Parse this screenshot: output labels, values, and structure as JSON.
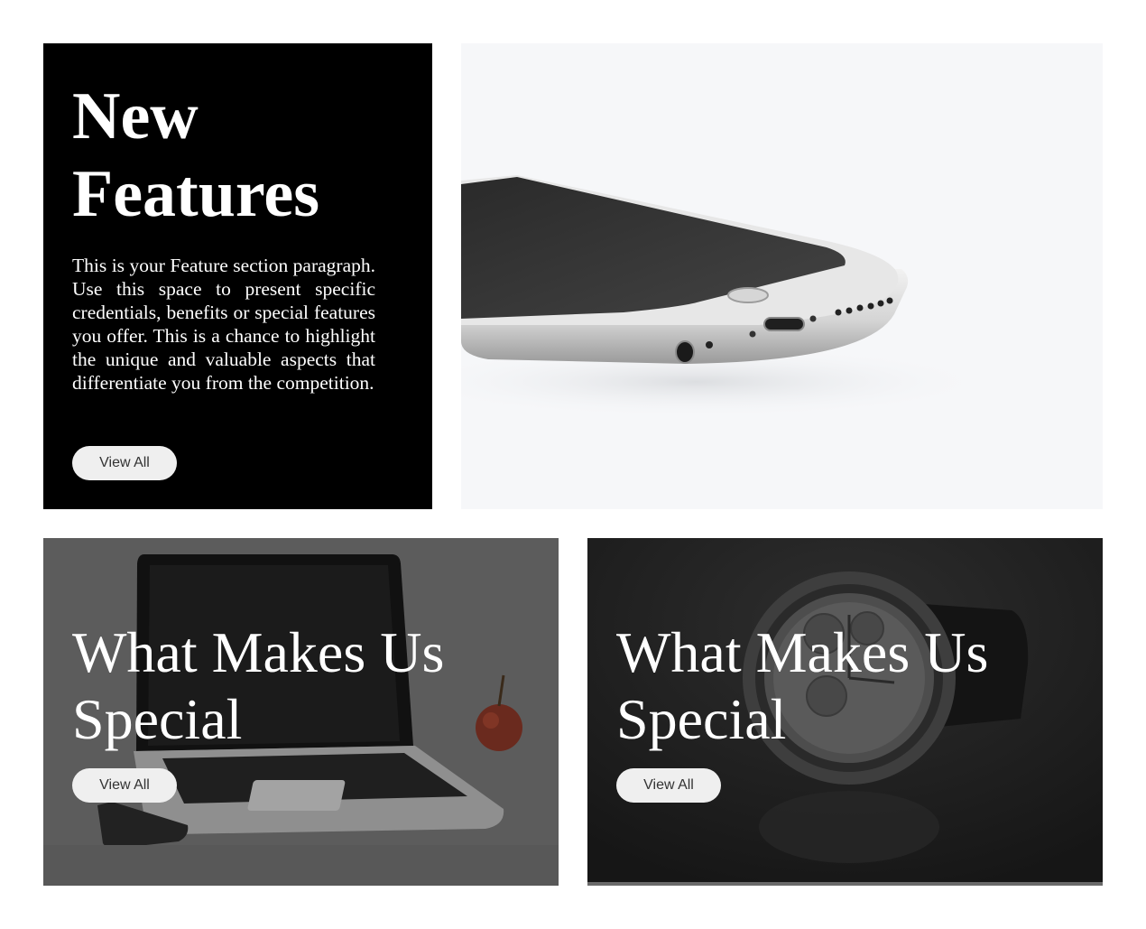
{
  "feature": {
    "title_line1": "New",
    "title_line2": "Features",
    "paragraph": "This is your Feature section paragraph. Use this space to present specific credentials, benefits or special features you offer. This is a chance to highlight the unique and valuable aspects that differentiate you from the competition.",
    "button_label": "View All"
  },
  "phone_image": {
    "icon": "smartphone-photo"
  },
  "promo_cards": [
    {
      "title_line1": "What Makes Us",
      "title_line2": "Special",
      "button_label": "View All",
      "icon": "laptop-apple-photo"
    },
    {
      "title_line1": "What Makes Us",
      "title_line2": "Special",
      "button_label": "View All",
      "icon": "wristwatch-photo"
    }
  ],
  "colors": {
    "feature_background": "#000000",
    "button_background": "#efefef",
    "button_text": "#333333",
    "laptop_overlay": "#5c5c5c",
    "watch_overlay": "#1c1c1c"
  }
}
